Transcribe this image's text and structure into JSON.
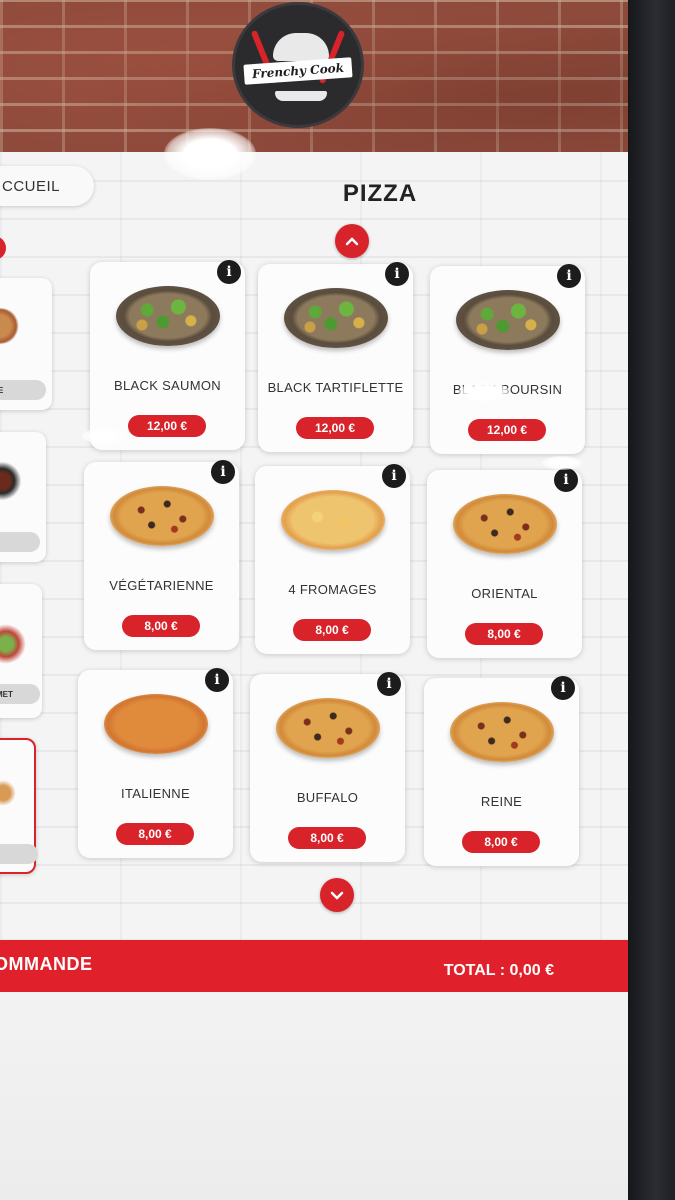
{
  "brand": {
    "logo_text": "Frenchy Cook"
  },
  "nav": {
    "home_label": "CCUEIL"
  },
  "category": {
    "title": "PIZZA"
  },
  "sidebar": {
    "items": [
      {
        "label": "E",
        "active": false
      },
      {
        "label": "",
        "active": false
      },
      {
        "label": "MET",
        "active": false
      },
      {
        "label": "",
        "active": true
      }
    ]
  },
  "products": [
    {
      "name": "BLACK SAUMON",
      "price": "12,00 €",
      "style": "black"
    },
    {
      "name": "BLACK TARTIFLETTE",
      "price": "12,00 €",
      "style": "black"
    },
    {
      "name": "BLACK BOURSIN",
      "price": "12,00 €",
      "style": "black"
    },
    {
      "name": "VÉGÉTARIENNE",
      "price": "8,00 €",
      "style": "classic"
    },
    {
      "name": "4 FROMAGES",
      "price": "8,00 €",
      "style": "cheese"
    },
    {
      "name": "ORIENTAL",
      "price": "8,00 €",
      "style": "classic"
    },
    {
      "name": "ITALIENNE",
      "price": "8,00 €",
      "style": "marg"
    },
    {
      "name": "BUFFALO",
      "price": "8,00 €",
      "style": "classic"
    },
    {
      "name": "REINE",
      "price": "8,00 €",
      "style": "classic"
    }
  ],
  "order": {
    "label": "OMMANDE",
    "total": "TOTAL : 0,00 €"
  },
  "colors": {
    "accent": "#d8232a",
    "info_icon": "#1c1c1c"
  }
}
